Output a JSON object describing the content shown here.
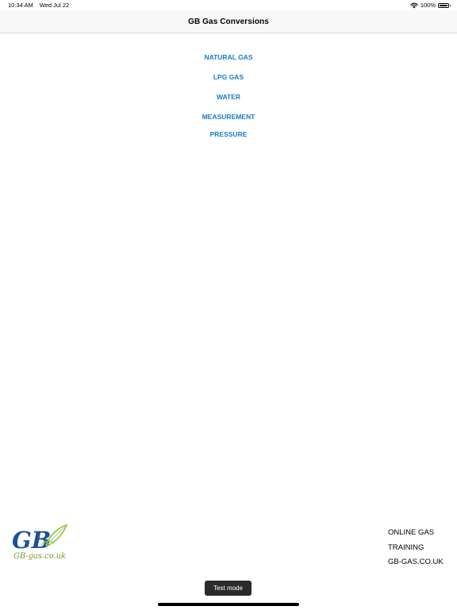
{
  "status_bar": {
    "time": "10:34 AM",
    "date": "Wed Jul 22",
    "battery": "100%"
  },
  "nav": {
    "title": "GB Gas Conversions"
  },
  "menu": {
    "items": [
      {
        "label": "NATURAL GAS"
      },
      {
        "label": "LPG GAS"
      },
      {
        "label": "WATER"
      },
      {
        "label": "MEASUREMENT"
      },
      {
        "label": "PRESSURE"
      }
    ]
  },
  "colors": {
    "link": "#1a7cc4",
    "logo_blue": "#1d4f9e",
    "logo_green": "#8cc63f"
  },
  "footer": {
    "logo_text": "GB-gas.co.uk",
    "lines": [
      "ONLINE GAS",
      "TRAINING",
      "GB-GAS.CO.UK"
    ]
  },
  "toast": {
    "text": "Test mode"
  }
}
